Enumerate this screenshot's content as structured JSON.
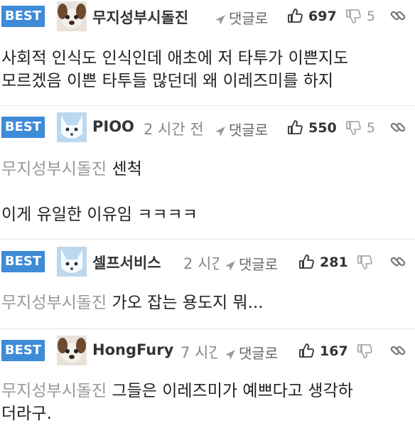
{
  "labels": {
    "best": "BEST",
    "reply": "댓글로"
  },
  "comments": [
    {
      "nickname": "무지성부시돌진",
      "time": "",
      "upvotes": "697",
      "downvotes": "5",
      "mention": "",
      "lines": [
        "사회적 인식도 인식인데 애초에 저 타투가 이쁜지도",
        "모르겠음 이쁜 타투들 많던데 왜 이레즈미를 하지"
      ],
      "avatar": "dog-avatar"
    },
    {
      "nickname": "PIOO",
      "time": "2 시간 전",
      "upvotes": "550",
      "downvotes": "5",
      "mention": "무지성부시돌진",
      "lines": [
        "센척",
        "",
        "이게 유일한 이유임 ㅋㅋㅋㅋ"
      ],
      "avatar": "fox-avatar"
    },
    {
      "nickname": "셀프서비스",
      "time": "2 시간 전",
      "upvotes": "281",
      "downvotes": "",
      "mention": "무지성부시돌진",
      "lines": [
        "가오 잡는 용도지 뭐..."
      ],
      "avatar": "fox-avatar"
    },
    {
      "nickname": "HongFury",
      "time": "7 시간 전",
      "upvotes": "167",
      "downvotes": "",
      "mention": "무지성부시돌진",
      "lines": [
        "그들은 이레즈미가 예쁘다고 생각하",
        "더라구."
      ],
      "avatar": "dog-avatar"
    }
  ],
  "colors": {
    "best_badge": "#3e8bd8",
    "mention": "#999999"
  }
}
